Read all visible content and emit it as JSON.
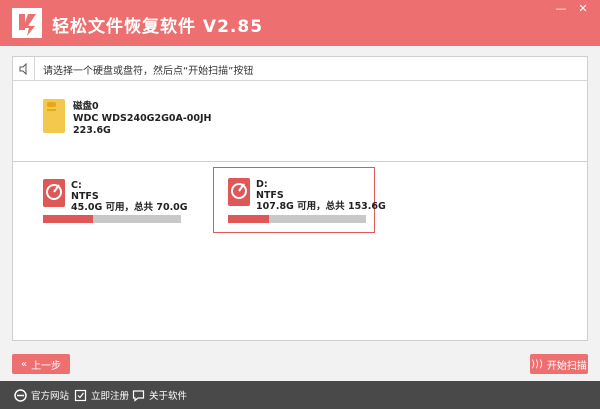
{
  "window": {
    "title": "轻松文件恢复软件 V2.85",
    "minimize": "—",
    "close": "✕"
  },
  "hint": "请选择一个硬盘或盘符，然后点“开始扫描”按钮",
  "disk": {
    "name": "磁盘0",
    "model": "WDC WDS240G2G0A-00JH",
    "size": "223.6G"
  },
  "partitions": [
    {
      "letter": "C:",
      "fs": "NTFS",
      "info": "45.0G 可用，总共 70.0G",
      "used_fraction": 0.36,
      "selected": false
    },
    {
      "letter": "D:",
      "fs": "NTFS",
      "info": "107.8G 可用，总共 153.6G",
      "used_fraction": 0.3,
      "selected": true
    }
  ],
  "buttons": {
    "back": "上一步",
    "start": "开始扫描"
  },
  "footer": {
    "website": "官方网站",
    "register": "立即注册",
    "about": "关于软件"
  },
  "colors": {
    "accent": "#ee6f6f",
    "bar_used": "#e05757",
    "bar_free": "#c8c8c8",
    "disk_icon": "#f2c94c",
    "footer": "#494949"
  }
}
